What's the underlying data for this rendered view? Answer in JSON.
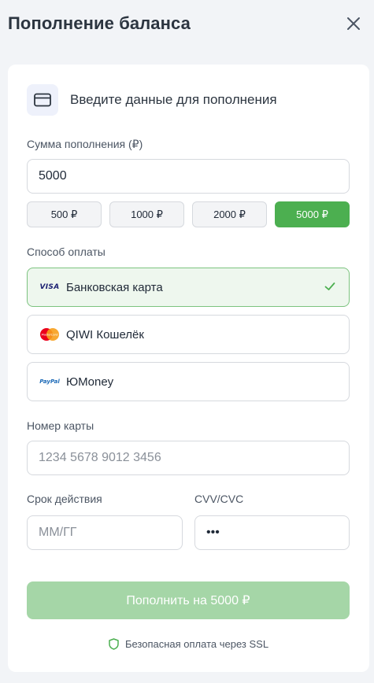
{
  "header": {
    "title": "Пополнение баланса"
  },
  "card": {
    "title": "Введите данные для пополнения"
  },
  "amount": {
    "label": "Сумма пополнения (₽)",
    "value": "5000",
    "presets": [
      "500 ₽",
      "1000 ₽",
      "2000 ₽",
      "5000 ₽"
    ],
    "selected_index": 3
  },
  "payment": {
    "label": "Способ оплаты",
    "methods": [
      {
        "name": "Банковская карта",
        "logo": "VISA",
        "icon": "visa-icon",
        "selected": true
      },
      {
        "name": "QIWI Кошелёк",
        "logo": "MasterCard",
        "icon": "mastercard-icon",
        "selected": false
      },
      {
        "name": "ЮMoney",
        "logo": "PayPal",
        "icon": "paypal-icon",
        "selected": false
      }
    ]
  },
  "card_number": {
    "label": "Номер карты",
    "placeholder": "1234 5678 9012 3456"
  },
  "expiry": {
    "label": "Срок действия",
    "placeholder": "ММ/ГГ"
  },
  "cvv": {
    "label": "CVV/CVC",
    "value": "•••"
  },
  "submit": {
    "label": "Пополнить на 5000 ₽"
  },
  "secure": {
    "text": "Безопасная оплата через SSL"
  },
  "colors": {
    "accent": "#4caf50",
    "accent_disabled": "#a5d6a7",
    "selected_bg": "#eef7ee"
  }
}
